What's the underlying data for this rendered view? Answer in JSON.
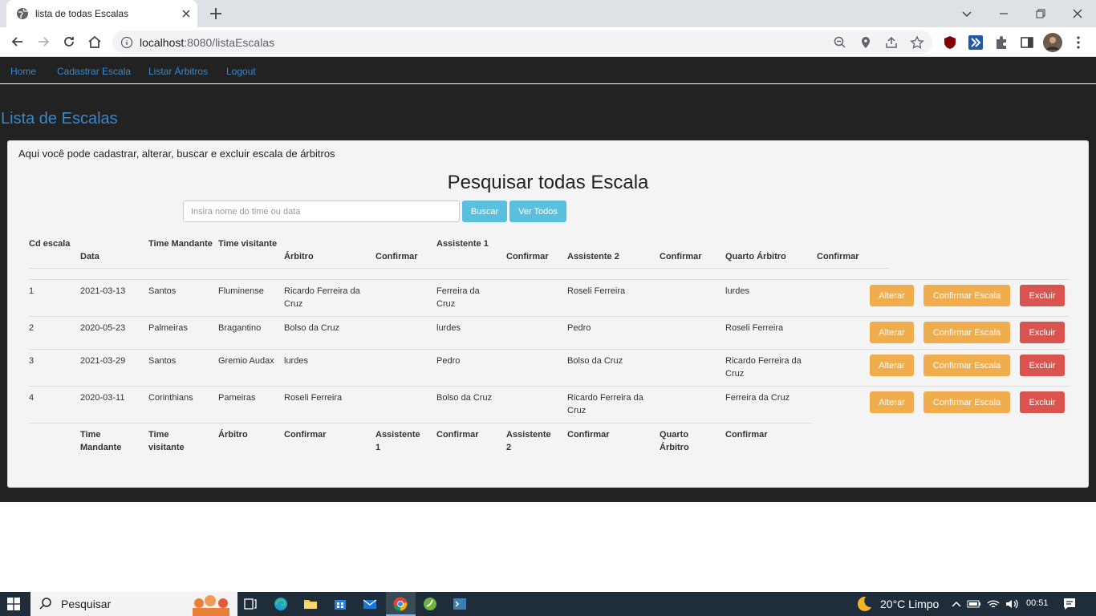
{
  "browser": {
    "tab_title": "lista de todas Escalas",
    "url_host": "localhost",
    "url_rest": ":8080/listaEscalas"
  },
  "nav": {
    "home": "Home",
    "cadastrar": "Cadastrar Escala",
    "listar": "Listar Árbitros",
    "logout": "Logout"
  },
  "page": {
    "title": "Lista de Escalas",
    "intro": "Aqui você pode cadastrar, alterar, buscar e excluir escala de árbitros",
    "search_title": "Pesquisar todas Escala",
    "search_placeholder": "Insira nome do time ou data",
    "buscar": "Buscar",
    "ver_todos": "Ver Todos"
  },
  "table": {
    "headers": [
      "Cd escala",
      "Data",
      "Time Mandante",
      "Time visitante",
      "Árbitro",
      "Confirmar",
      "Assistente 1",
      "Confirmar",
      "Assistente 2",
      "Confirmar",
      "Quarto Árbitro",
      "Confirmar"
    ],
    "rows": [
      {
        "cd": "1",
        "data": "2021-03-13",
        "mandante": "Santos",
        "visitante": "Fluminense",
        "arbitro": "Ricardo Ferreira da Cruz",
        "c1": "",
        "assist1": "Ferreira da Cruz",
        "c2": "",
        "assist2": "Roseli Ferreira",
        "c3": "",
        "quarto": "lurdes",
        "c4": ""
      },
      {
        "cd": "2",
        "data": "2020-05-23",
        "mandante": "Palmeiras",
        "visitante": "Bragantino",
        "arbitro": "Bolso da Cruz",
        "c1": "",
        "assist1": "lurdes",
        "c2": "",
        "assist2": "Pedro",
        "c3": "",
        "quarto": "Roseli Ferreira",
        "c4": ""
      },
      {
        "cd": "3",
        "data": "2021-03-29",
        "mandante": "Santos",
        "visitante": "Gremio Audax",
        "arbitro": "lurdes",
        "c1": "",
        "assist1": "Pedro",
        "c2": "",
        "assist2": "Bolso da Cruz",
        "c3": "",
        "quarto": "Ricardo Ferreira da Cruz",
        "c4": ""
      },
      {
        "cd": "4",
        "data": "2020-03-11",
        "mandante": "Corinthians",
        "visitante": "Pameiras",
        "arbitro": "Roseli Ferreira",
        "c1": "",
        "assist1": "Bolso da Cruz",
        "c2": "",
        "assist2": "Ricardo Ferreira da Cruz",
        "c3": "",
        "quarto": "Ferreira da Cruz",
        "c4": ""
      }
    ],
    "row_actions": {
      "alterar": "Alterar",
      "confirmar": "Confirmar Escala",
      "excluir": "Excluir"
    },
    "footer": [
      "Time Mandante",
      "Time visitante",
      "Árbitro",
      "Confirmar",
      "Assistente 1",
      "Confirmar",
      "Assistente 2",
      "Confirmar",
      "Quarto Árbitro",
      "Confirmar"
    ]
  },
  "taskbar": {
    "search": "Pesquisar",
    "weather": "20°C  Limpo",
    "time": "00:51"
  }
}
